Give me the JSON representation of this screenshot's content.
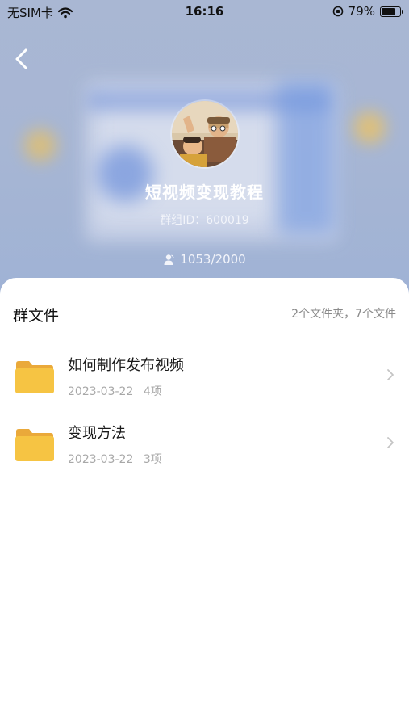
{
  "status_bar": {
    "carrier": "无SIM卡",
    "time": "16:16",
    "battery_percent": "79%",
    "battery_level": 0.79
  },
  "header": {
    "group_name": "短视频变现教程",
    "group_id": "群组ID：600019",
    "member_count": "1053/2000"
  },
  "files_panel": {
    "title": "群文件",
    "summary": "2个文件夹，7个文件",
    "folders": [
      {
        "name": "如何制作发布视频",
        "date": "2023-03-22",
        "count": "4项"
      },
      {
        "name": "变现方法",
        "date": "2023-03-22",
        "count": "3项"
      }
    ]
  },
  "colors": {
    "hero_bg": "#a7b6d4",
    "folder": "#f6c443",
    "folder_tab": "#eaa93a"
  }
}
